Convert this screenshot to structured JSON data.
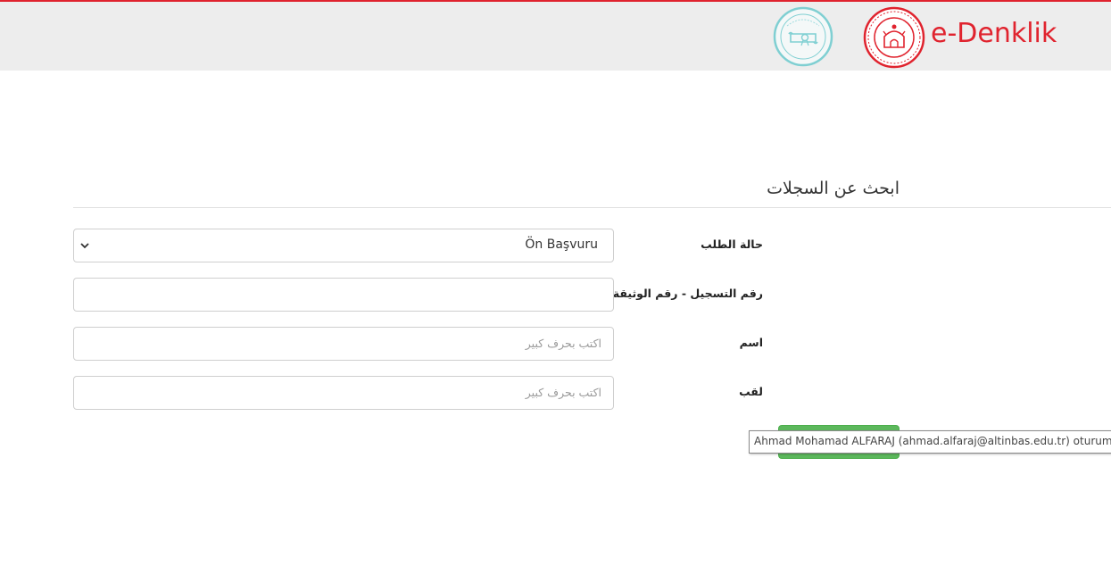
{
  "header": {
    "brand_name": "e-Denklik",
    "brand_color": "#e0232e",
    "seal_logo_icon": "diploma-seal-logo-icon",
    "meb_logo_icon": "ministry-emblem-logo-icon",
    "seal_logo_text": "e-denklik"
  },
  "search": {
    "title": "ابحث عن السجلات",
    "fields": [
      {
        "label": "حالة الطلب",
        "type": "select",
        "value": "Ön Başvuru"
      },
      {
        "label": "رقم التسجيل - رقم الوثيقة",
        "type": "text",
        "value": "",
        "placeholder": ""
      },
      {
        "label": "اسم",
        "type": "text",
        "value": "",
        "placeholder": "اكتب بحرف كبير"
      },
      {
        "label": "لقب",
        "type": "text",
        "value": "",
        "placeholder": "اكتب بحرف كبير"
      }
    ],
    "button_color": "#5cb85c"
  },
  "tooltip": {
    "text": "Ahmad Mohamad ALFARAJ (ahmad.alfaraj@altinbas.edu.tr) oturum a"
  }
}
